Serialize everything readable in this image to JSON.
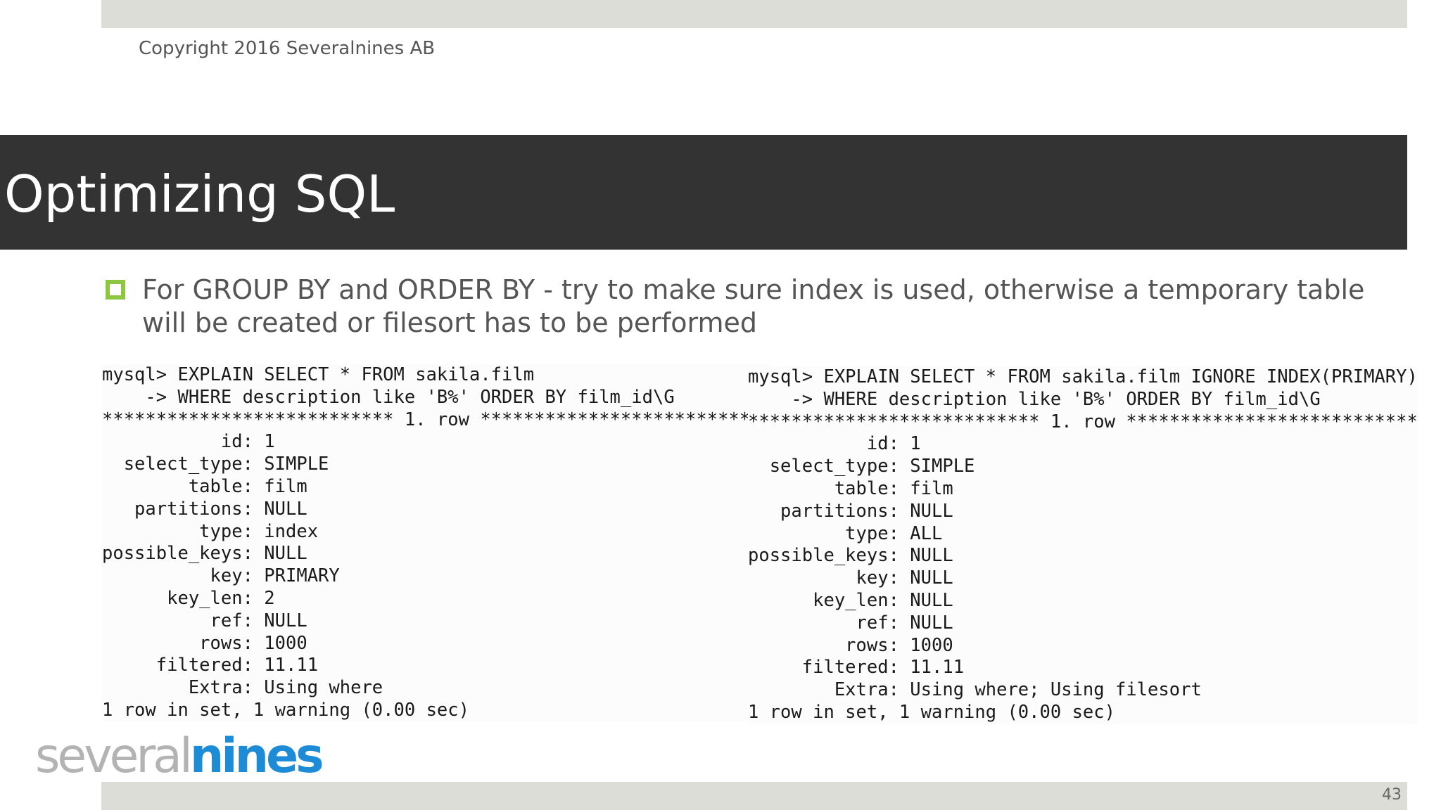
{
  "header": {
    "copyright": "Copyright 2016 Severalnines AB"
  },
  "slide": {
    "title": "Optimizing SQL",
    "bullet": "For GROUP BY and ORDER BY - try to make sure index is used, otherwise a temporary table will be created or filesort has to be performed",
    "page_number": "43"
  },
  "code": {
    "left": "mysql> EXPLAIN SELECT * FROM sakila.film\n    -> WHERE description like 'B%' ORDER BY film_id\\G\n*************************** 1. row ***************************\n           id: 1\n  select_type: SIMPLE\n        table: film\n   partitions: NULL\n         type: index\npossible_keys: NULL\n          key: PRIMARY\n      key_len: 2\n          ref: NULL\n         rows: 1000\n     filtered: 11.11\n        Extra: Using where\n1 row in set, 1 warning (0.00 sec)",
    "right": "mysql> EXPLAIN SELECT * FROM sakila.film IGNORE INDEX(PRIMARY)\n    -> WHERE description like 'B%' ORDER BY film_id\\G\n*************************** 1. row ***************************\n           id: 1\n  select_type: SIMPLE\n        table: film\n   partitions: NULL\n         type: ALL\npossible_keys: NULL\n          key: NULL\n      key_len: NULL\n          ref: NULL\n         rows: 1000\n     filtered: 11.11\n        Extra: Using where; Using filesort\n1 row in set, 1 warning (0.00 sec)"
  },
  "logo": {
    "part1": "several",
    "part2": "nines"
  },
  "colors": {
    "title_banner": "#333333",
    "bullet_marker": "#8dc63f",
    "logo_blue": "#1d8bd6",
    "logo_gray": "#b3b3b3",
    "bar_gray": "#dcddd7"
  }
}
